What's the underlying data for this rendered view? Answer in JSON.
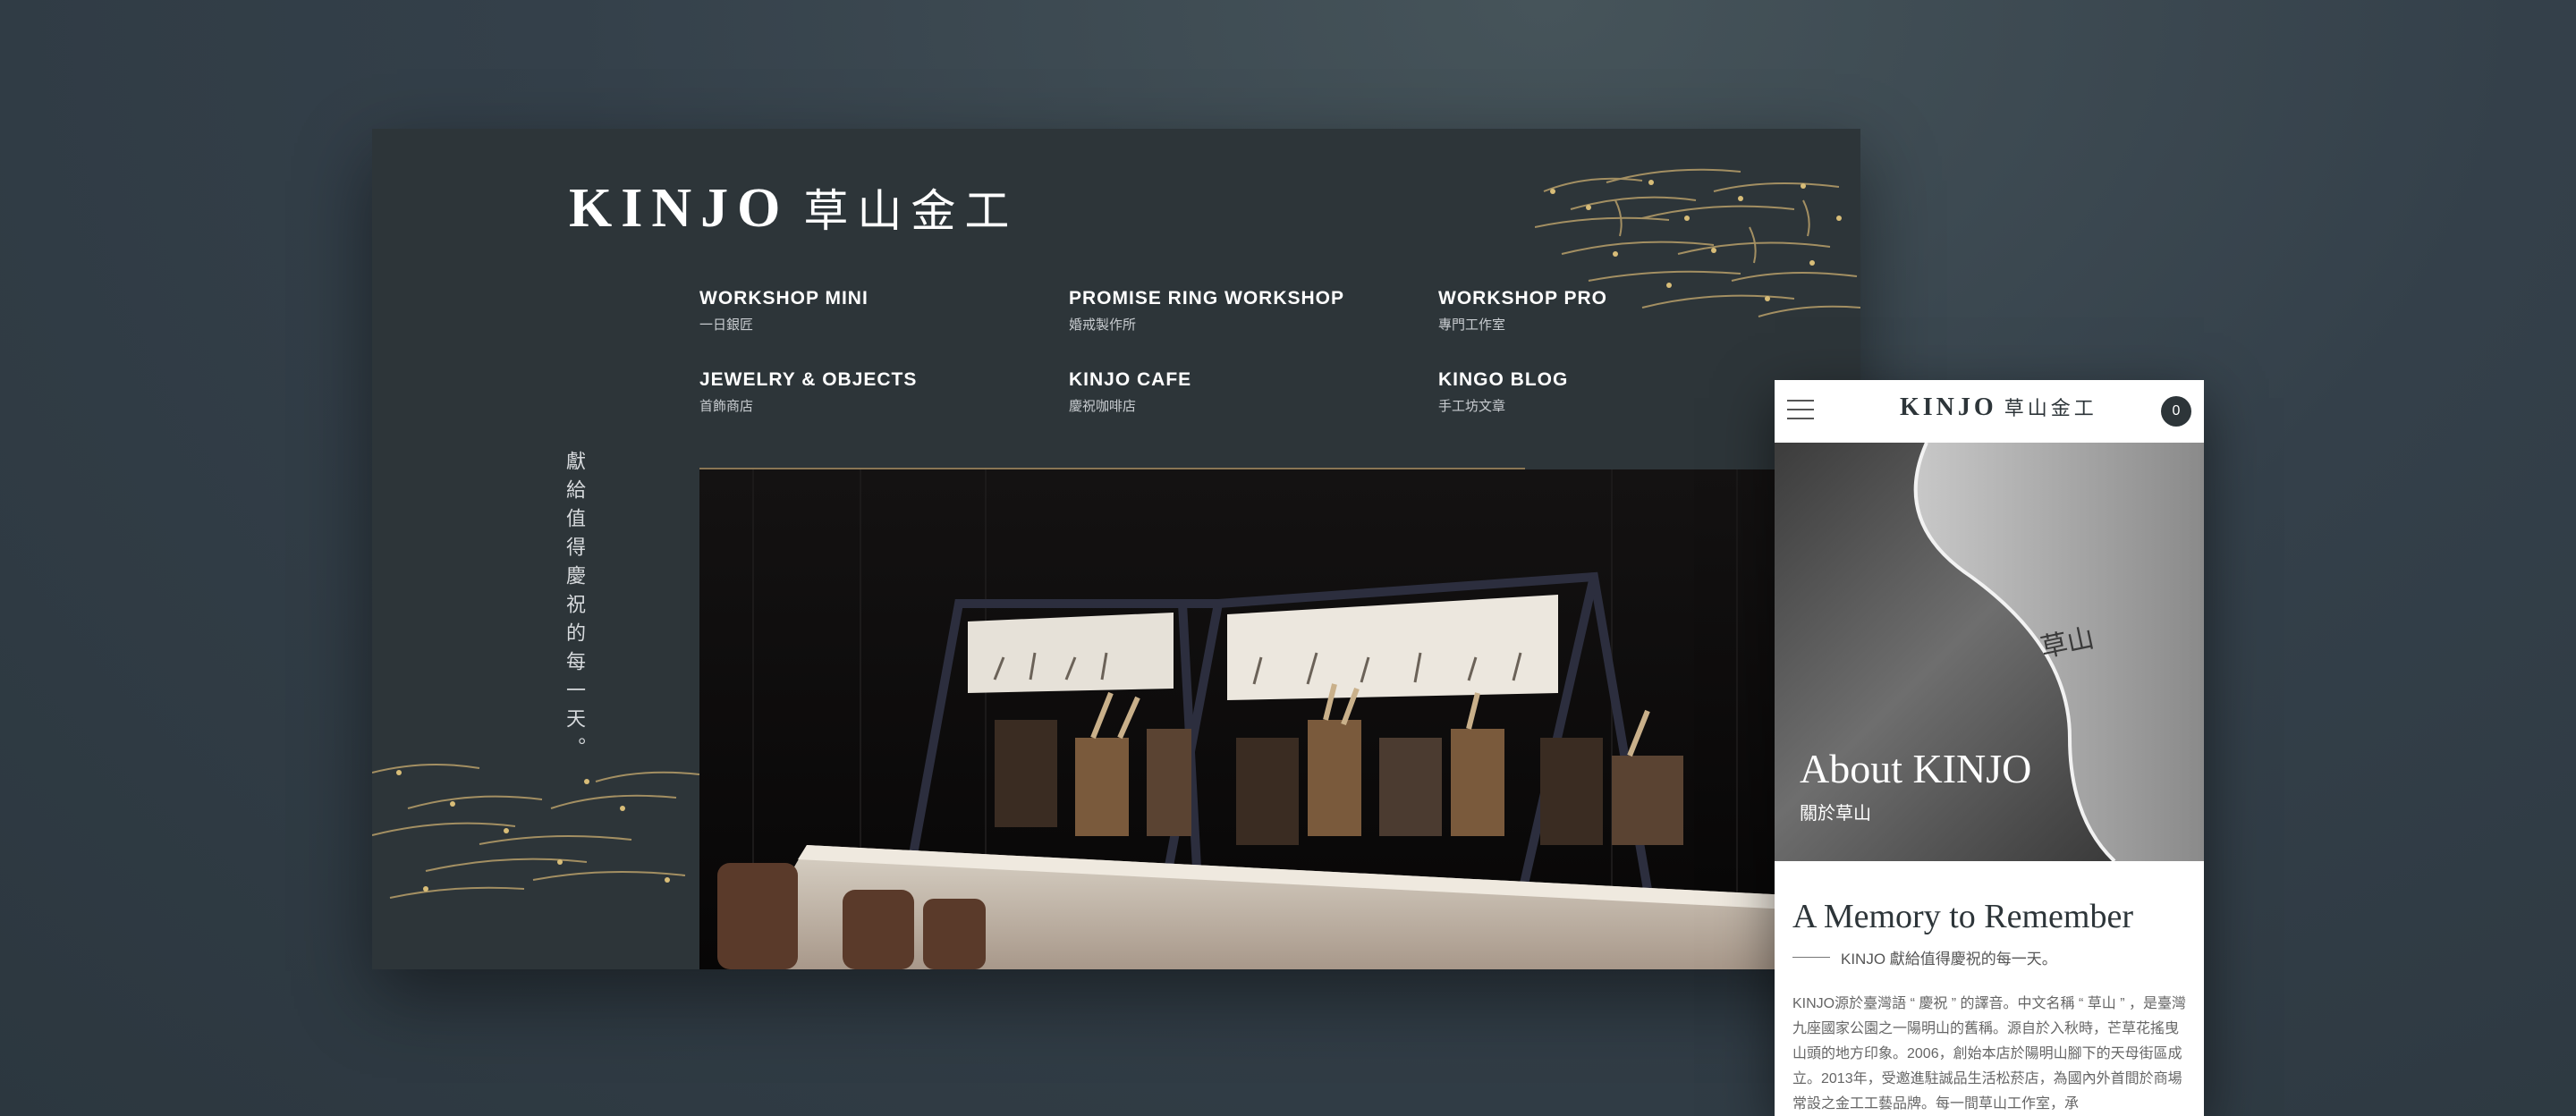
{
  "desktop": {
    "logo": {
      "en": "KINJO",
      "zh": "草山金工"
    },
    "nav": [
      {
        "en": "WORKSHOP MINI",
        "zh": "一日銀匠"
      },
      {
        "en": "PROMISE RING WORKSHOP",
        "zh": "婚戒製作所"
      },
      {
        "en": "WORKSHOP PRO",
        "zh": "專門工作室"
      },
      {
        "en": "JEWELRY & OBJECTS",
        "zh": "首飾商店"
      },
      {
        "en": "KINJO CAFE",
        "zh": "慶祝咖啡店"
      },
      {
        "en": "KINGO BLOG",
        "zh": "手工坊文章"
      }
    ],
    "vertical_tagline": "獻給值得慶祝的每一天。"
  },
  "mobile": {
    "logo": {
      "en": "KINJO",
      "zh": "草山金工"
    },
    "cart_count": "0",
    "hero_title": "About KINJO",
    "hero_subtitle": "關於草山",
    "section_title": "A Memory to Remember",
    "section_tagline": "KINJO 獻給值得慶祝的每一天。",
    "body": "KINJO源於臺灣語 “ 慶祝 ” 的譯音。中文名稱 “ 草山 ” ，是臺灣九座國家公園之一陽明山的舊稱。源自於入秋時，芒草花搖曳山頭的地方印象。2006，創始本店於陽明山腳下的天母街區成立。2013年，受邀進駐誠品生活松菸店，為國內外首間於商場常設之金工工藝品牌。每一間草山工作室，承"
  },
  "colors": {
    "dark": "#2d3539",
    "gold": "#c9a862",
    "background": "#34404a"
  }
}
